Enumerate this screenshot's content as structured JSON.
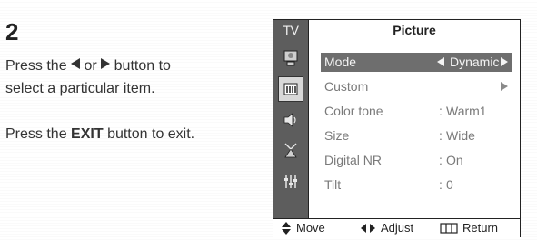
{
  "instructions": {
    "step_number": "2",
    "line1_prefix": "Press the",
    "line1_or": "or",
    "line1_suffix": "button to",
    "line2": "select a particular item.",
    "line3_prefix": "Press the",
    "line3_key": "EXIT",
    "line3_suffix": "button to exit."
  },
  "osd": {
    "sidebar_label": "TV",
    "title": "Picture",
    "sidebar_icons": [
      "picture-icon",
      "sound-icon",
      "channel-icon",
      "setup-icon",
      "input-icon",
      "guide-icon"
    ],
    "active_icon_index": 1,
    "rows": [
      {
        "label": "Mode",
        "value": "Dynamic",
        "selected": true
      },
      {
        "label": "Custom",
        "value": "",
        "has_submenu": true
      },
      {
        "label": "Color tone",
        "value": "Warm1"
      },
      {
        "label": "Size",
        "value": "Wide"
      },
      {
        "label": "Digital NR",
        "value": "On"
      },
      {
        "label": "Tilt",
        "value": "0"
      }
    ],
    "footer": {
      "move": "Move",
      "adjust": "Adjust",
      "return": "Return"
    }
  },
  "colors": {
    "sidebar": "#5d5d5d",
    "selected_row": "#6e6e6e",
    "inactive_text": "#7a7a7a"
  }
}
